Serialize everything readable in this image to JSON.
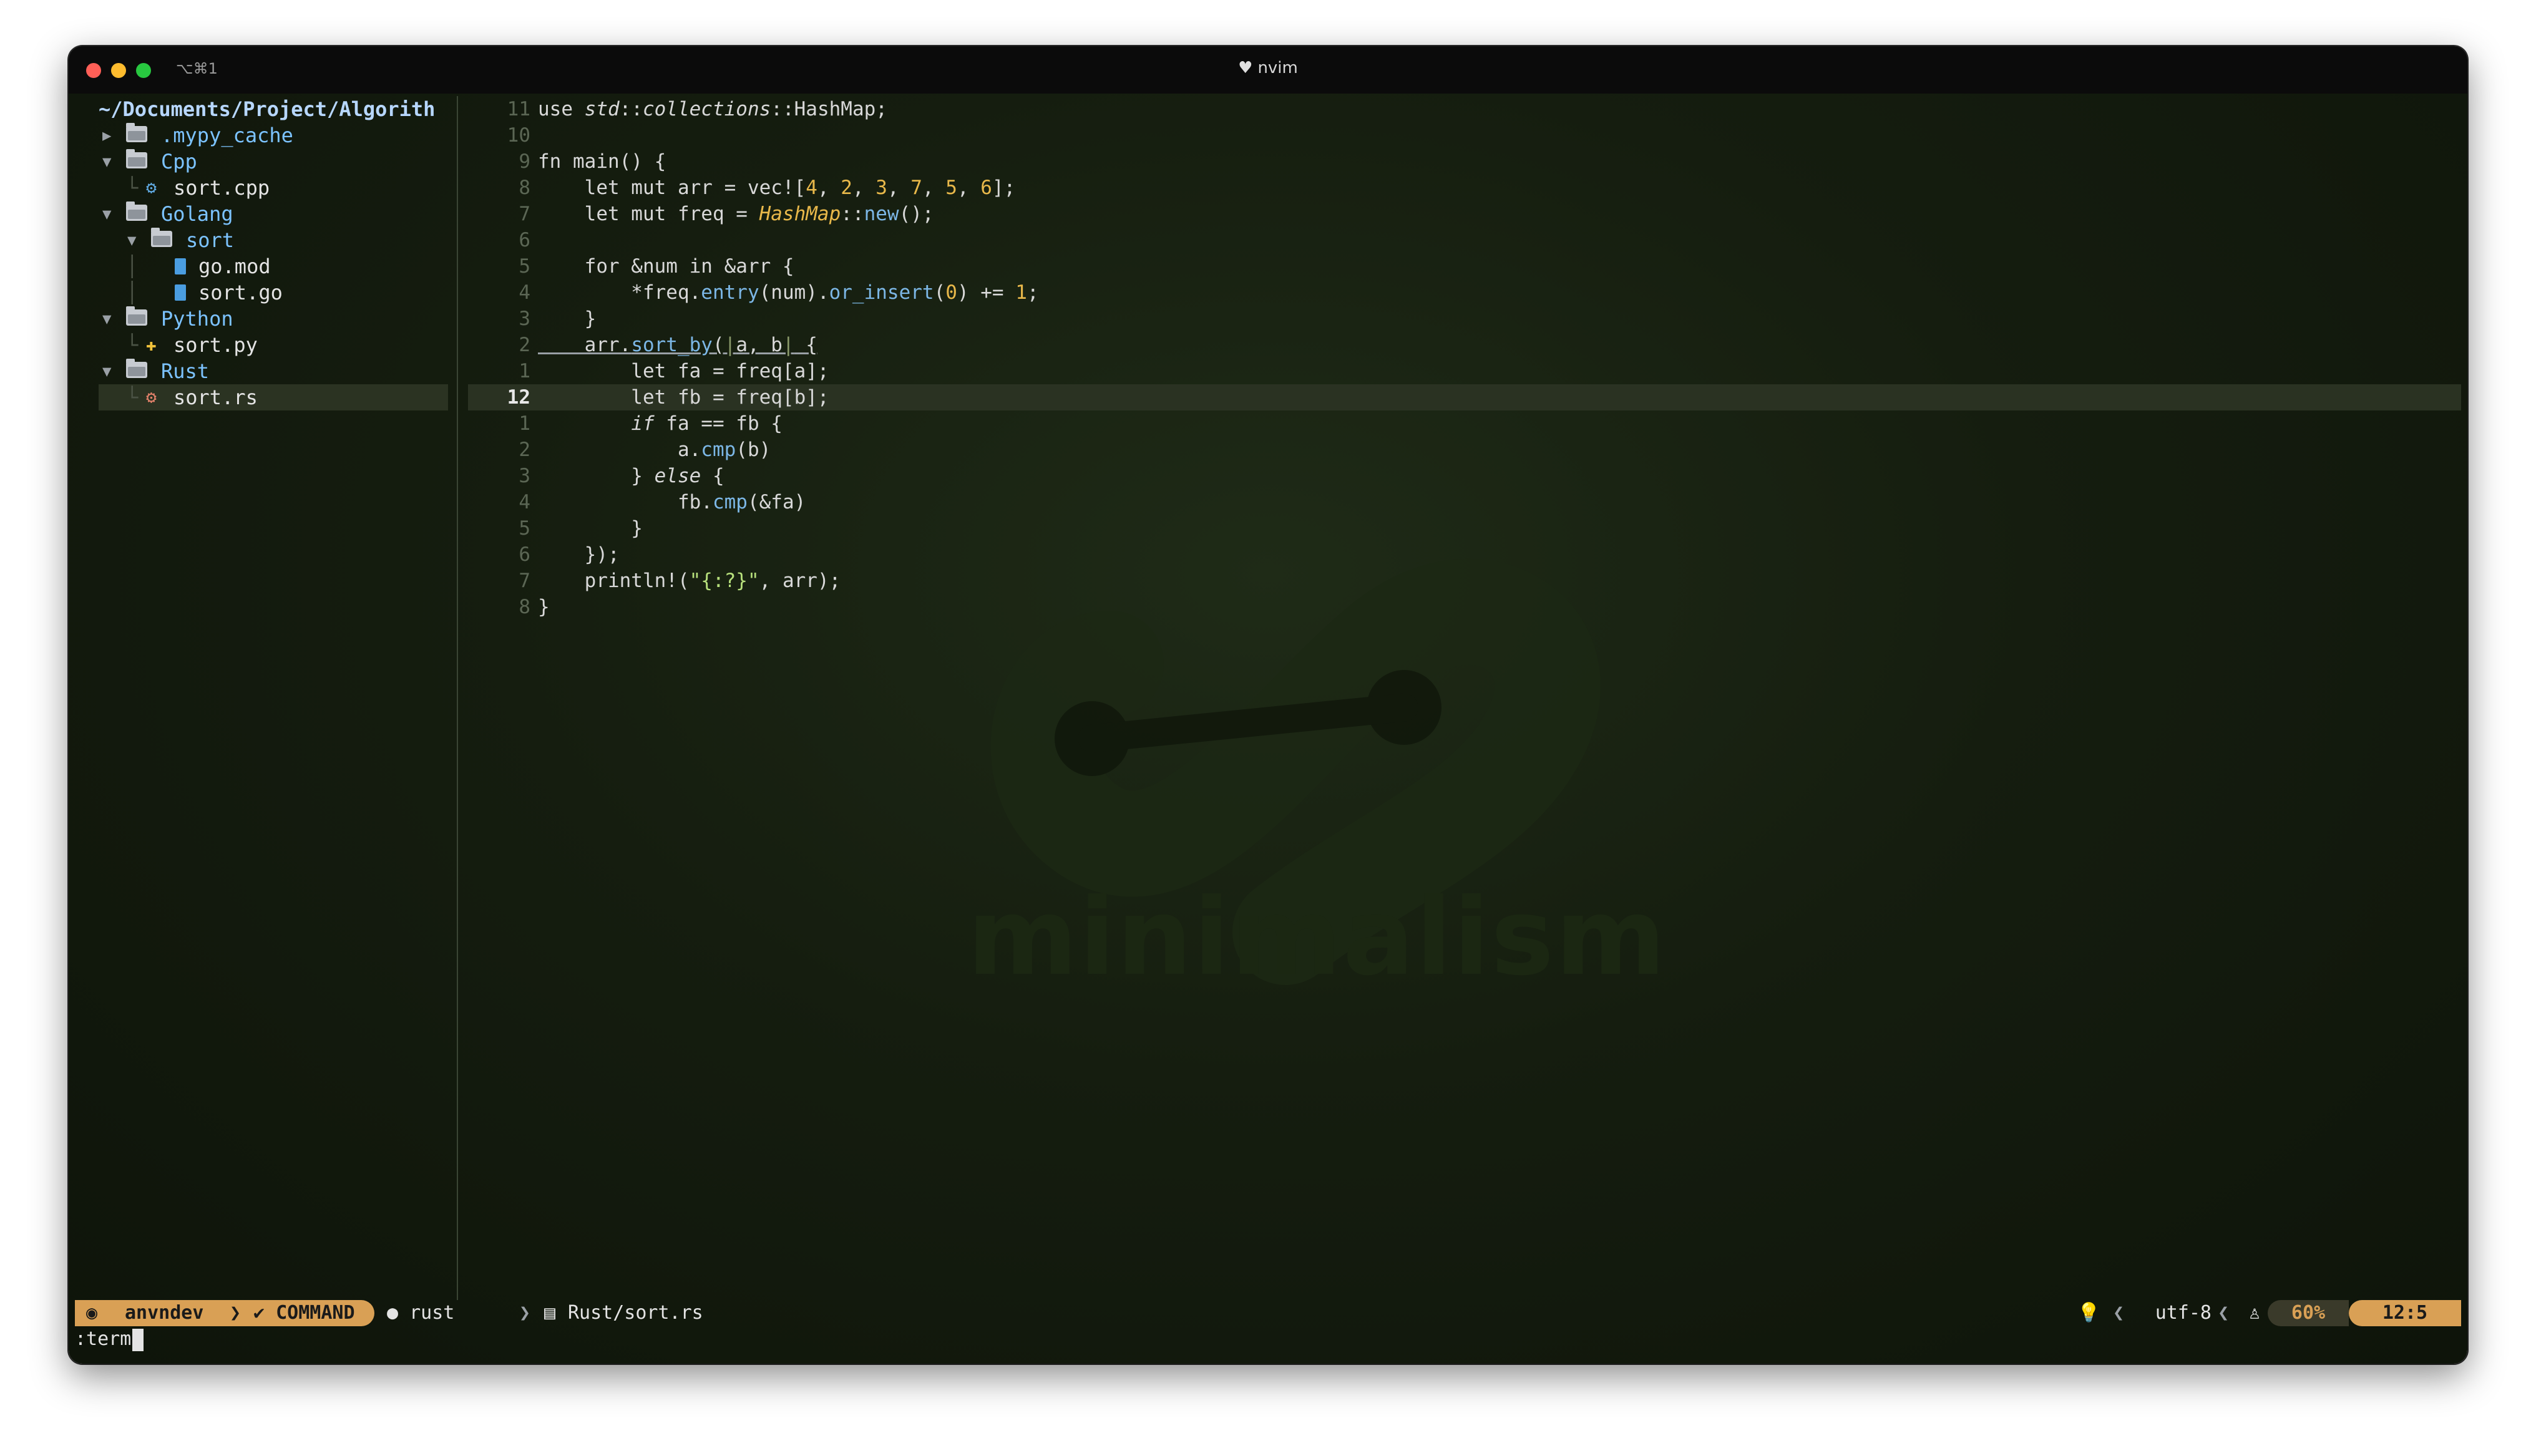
{
  "window": {
    "tab_shortcut": "⌥⌘1",
    "title": "nvim",
    "title_icon": "heart-icon"
  },
  "watermark": {
    "text": "minimalism"
  },
  "tree": {
    "root": "~/Documents/Project/Algorith",
    "items": [
      {
        "type": "dir",
        "name": ".mypy_cache",
        "expanded": false
      },
      {
        "type": "dir",
        "name": "Cpp",
        "expanded": true
      },
      {
        "type": "file",
        "name": "sort.cpp",
        "icon": "cpp-icon"
      },
      {
        "type": "dir",
        "name": "Golang",
        "expanded": true
      },
      {
        "type": "dir",
        "name": "sort",
        "expanded": true
      },
      {
        "type": "file",
        "name": "go.mod",
        "icon": "go-mod-icon"
      },
      {
        "type": "file",
        "name": "sort.go",
        "icon": "go-icon"
      },
      {
        "type": "dir",
        "name": "Python",
        "expanded": true
      },
      {
        "type": "file",
        "name": "sort.py",
        "icon": "python-icon"
      },
      {
        "type": "dir",
        "name": "Rust",
        "expanded": true
      },
      {
        "type": "file",
        "name": "sort.rs",
        "icon": "rust-icon",
        "selected": true
      }
    ]
  },
  "editor": {
    "lines": [
      {
        "n": "11",
        "code": "use std::collections::HashMap;"
      },
      {
        "n": "10",
        "code": ""
      },
      {
        "n": "9",
        "code": "fn main() {"
      },
      {
        "n": "8",
        "code": "    let mut arr = vec![4, 2, 3, 7, 5, 6];"
      },
      {
        "n": "7",
        "code": "    let mut freq = HashMap::new();"
      },
      {
        "n": "6",
        "code": ""
      },
      {
        "n": "5",
        "code": "    for &num in &arr {"
      },
      {
        "n": "4",
        "code": "        *freq.entry(num).or_insert(0) += 1;"
      },
      {
        "n": "3",
        "code": "    }"
      },
      {
        "n": "2",
        "code": "    arr.sort_by(|a, b| {"
      },
      {
        "n": "1",
        "code": "        let fa = freq[a];"
      },
      {
        "n": "12",
        "code": "        let fb = freq[b];",
        "current": true
      },
      {
        "n": "1",
        "code": "        if fa == fb {"
      },
      {
        "n": "2",
        "code": "            a.cmp(b)"
      },
      {
        "n": "3",
        "code": "        } else {"
      },
      {
        "n": "4",
        "code": "            fb.cmp(&fa)"
      },
      {
        "n": "5",
        "code": "        }"
      },
      {
        "n": "6",
        "code": "    });"
      },
      {
        "n": "7",
        "code": "    println!(\"{:?}\", arr);"
      },
      {
        "n": "8",
        "code": "}"
      }
    ]
  },
  "statusline": {
    "user": "anvndev",
    "mode": "COMMAND",
    "lsp": "rust",
    "file": "Rust/sort.rs",
    "encoding": "utf-8",
    "percent": "60%",
    "position": "12:5",
    "colors": {
      "accent": "#d9a055",
      "bg": "#151d0f"
    }
  },
  "cmdline": {
    "text": ":term"
  }
}
